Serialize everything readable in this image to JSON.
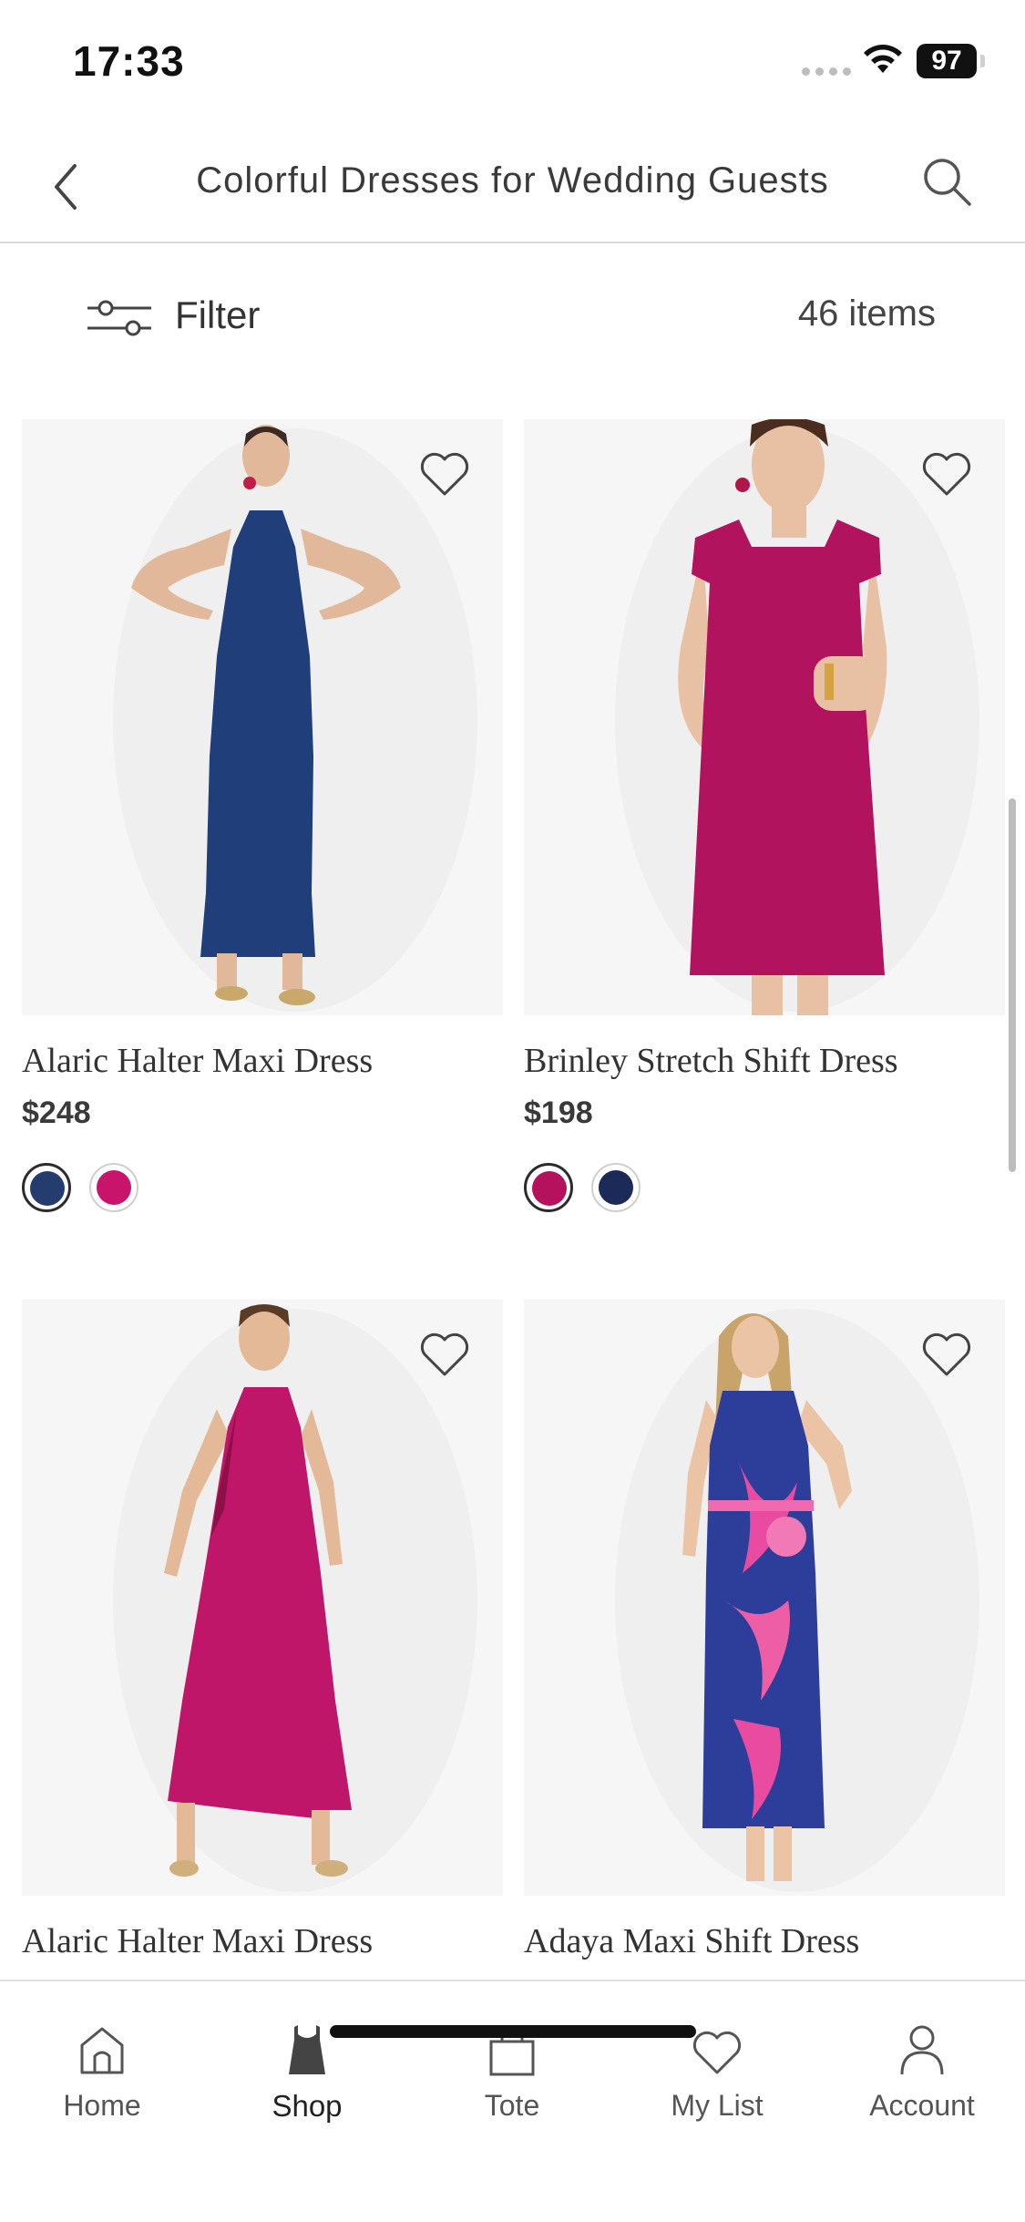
{
  "status_bar": {
    "time": "17:33",
    "battery": "97"
  },
  "header": {
    "title": "Colorful Dresses for Wedding Guests"
  },
  "filter": {
    "label": "Filter",
    "count": "46 items"
  },
  "products": [
    {
      "name": "Alaric Halter Maxi Dress",
      "price": "$248",
      "dress_color": "#1f3e7a",
      "swatches": [
        "#243d6e",
        "#c8156b"
      ]
    },
    {
      "name": "Brinley Stretch Shift Dress",
      "price": "$198",
      "dress_color": "#b2135f",
      "swatches": [
        "#b5125d",
        "#1b2a59"
      ]
    },
    {
      "name": "Alaric Halter Maxi Dress",
      "price": "",
      "dress_color": "#c0166a",
      "swatches": []
    },
    {
      "name": "Adaya Maxi Shift Dress",
      "price": "",
      "dress_color": "#2c3e9a",
      "swatches": []
    }
  ],
  "tabs": [
    {
      "label": "Home",
      "icon": "home-icon"
    },
    {
      "label": "Shop",
      "icon": "dress-icon",
      "active": true
    },
    {
      "label": "Tote",
      "icon": "bag-icon"
    },
    {
      "label": "My List",
      "icon": "heart-icon"
    },
    {
      "label": "Account",
      "icon": "person-icon"
    }
  ]
}
